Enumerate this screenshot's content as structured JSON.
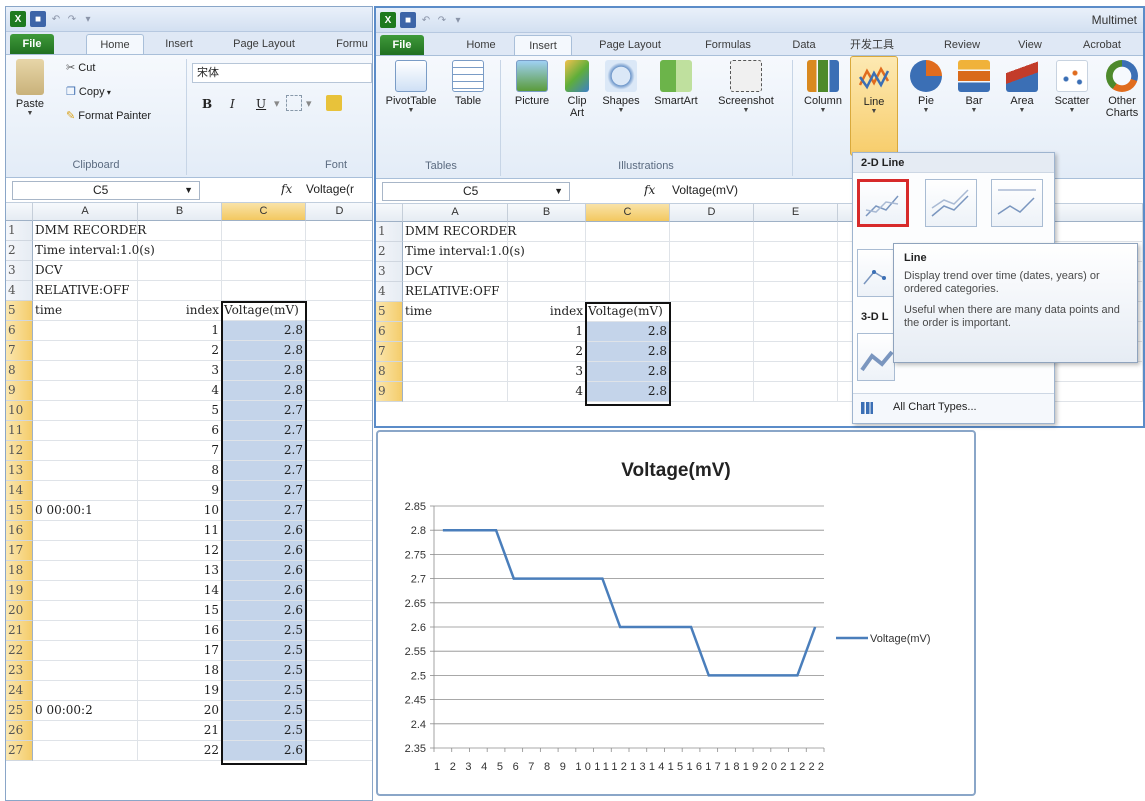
{
  "left_window": {
    "tabs": [
      "File",
      "Home",
      "Insert",
      "Page Layout",
      "Formu"
    ],
    "clipboard": {
      "paste": "Paste",
      "cut": "Cut",
      "copy": "Copy",
      "format_painter": "Format Painter",
      "group": "Clipboard"
    },
    "font": {
      "name": "宋体",
      "bold": "B",
      "italic": "I",
      "underline": "U",
      "group": "Font"
    },
    "namebox": "C5",
    "fx": "fx",
    "formula": "Voltage(r",
    "columns": [
      "A",
      "B",
      "C",
      "D"
    ],
    "rows": [
      {
        "n": "1",
        "a": "DMM RECORDER",
        "b": "",
        "c": ""
      },
      {
        "n": "2",
        "a": "Time interval:1.0(s)",
        "b": "",
        "c": ""
      },
      {
        "n": "3",
        "a": "DCV",
        "b": "",
        "c": ""
      },
      {
        "n": "4",
        "a": "RELATIVE:OFF",
        "b": "",
        "c": ""
      },
      {
        "n": "5",
        "a": "time",
        "b": "index",
        "c": "Voltage(mV)"
      },
      {
        "n": "6",
        "a": "",
        "b": "1",
        "c": "2.8"
      },
      {
        "n": "7",
        "a": "",
        "b": "2",
        "c": "2.8"
      },
      {
        "n": "8",
        "a": "",
        "b": "3",
        "c": "2.8"
      },
      {
        "n": "9",
        "a": "",
        "b": "4",
        "c": "2.8"
      },
      {
        "n": "10",
        "a": "",
        "b": "5",
        "c": "2.7"
      },
      {
        "n": "11",
        "a": "",
        "b": "6",
        "c": "2.7"
      },
      {
        "n": "12",
        "a": "",
        "b": "7",
        "c": "2.7"
      },
      {
        "n": "13",
        "a": "",
        "b": "8",
        "c": "2.7"
      },
      {
        "n": "14",
        "a": "",
        "b": "9",
        "c": "2.7"
      },
      {
        "n": "15",
        "a": "0 00:00:1",
        "b": "10",
        "c": "2.7"
      },
      {
        "n": "16",
        "a": "",
        "b": "11",
        "c": "2.6"
      },
      {
        "n": "17",
        "a": "",
        "b": "12",
        "c": "2.6"
      },
      {
        "n": "18",
        "a": "",
        "b": "13",
        "c": "2.6"
      },
      {
        "n": "19",
        "a": "",
        "b": "14",
        "c": "2.6"
      },
      {
        "n": "20",
        "a": "",
        "b": "15",
        "c": "2.6"
      },
      {
        "n": "21",
        "a": "",
        "b": "16",
        "c": "2.5"
      },
      {
        "n": "22",
        "a": "",
        "b": "17",
        "c": "2.5"
      },
      {
        "n": "23",
        "a": "",
        "b": "18",
        "c": "2.5"
      },
      {
        "n": "24",
        "a": "",
        "b": "19",
        "c": "2.5"
      },
      {
        "n": "25",
        "a": "0 00:00:2",
        "b": "20",
        "c": "2.5"
      },
      {
        "n": "26",
        "a": "",
        "b": "21",
        "c": "2.5"
      },
      {
        "n": "27",
        "a": "",
        "b": "22",
        "c": "2.6"
      }
    ]
  },
  "right_window": {
    "title": "Multimet",
    "tabs": [
      "File",
      "Home",
      "Insert",
      "Page Layout",
      "Formulas",
      "Data",
      "开发工具",
      "Review",
      "View",
      "Acrobat"
    ],
    "ribbon": {
      "pivottable": "PivotTable",
      "table": "Table",
      "tables_group": "Tables",
      "picture": "Picture",
      "clip_art": "Clip Art",
      "shapes": "Shapes",
      "smartart": "SmartArt",
      "screenshot": "Screenshot",
      "illustrations_group": "Illustrations",
      "column": "Column",
      "line": "Line",
      "pie": "Pie",
      "bar": "Bar",
      "area": "Area",
      "scatter": "Scatter",
      "other_charts": "Other Charts"
    },
    "namebox": "C5",
    "fx": "fx",
    "formula": "Voltage(mV)",
    "columns": [
      "A",
      "B",
      "C",
      "D",
      "E",
      "I"
    ],
    "rows": [
      {
        "n": "1",
        "a": "DMM RECORDER",
        "b": "",
        "c": ""
      },
      {
        "n": "2",
        "a": "Time interval:1.0(s)",
        "b": "",
        "c": ""
      },
      {
        "n": "3",
        "a": "DCV",
        "b": "",
        "c": ""
      },
      {
        "n": "4",
        "a": "RELATIVE:OFF",
        "b": "",
        "c": ""
      },
      {
        "n": "5",
        "a": "time",
        "b": "index",
        "c": "Voltage(mV)"
      },
      {
        "n": "6",
        "a": "",
        "b": "1",
        "c": "2.8"
      },
      {
        "n": "7",
        "a": "",
        "b": "2",
        "c": "2.8"
      },
      {
        "n": "8",
        "a": "",
        "b": "3",
        "c": "2.8"
      },
      {
        "n": "9",
        "a": "",
        "b": "4",
        "c": "2.8"
      }
    ]
  },
  "chart_menu": {
    "section_2d": "2-D Line",
    "section_3d": "3-D L",
    "all_types": "All Chart Types...",
    "tooltip": {
      "title": "Line",
      "p1": "Display trend over time (dates, years) or ordered categories.",
      "p2": "Useful when there are many data points and the order is important."
    }
  },
  "chart_data": {
    "type": "line",
    "title": "Voltage(mV)",
    "categories": [
      "1",
      "2",
      "3",
      "4",
      "5",
      "6",
      "7",
      "8",
      "9",
      "10",
      "11",
      "12",
      "13",
      "14",
      "15",
      "16",
      "17",
      "18",
      "19",
      "20",
      "21",
      "22"
    ],
    "tick_labels": "1 2 3 4 5 6 7 8 9 101112131415161718192021222",
    "series": [
      {
        "name": "Voltage(mV)",
        "values": [
          2.8,
          2.8,
          2.8,
          2.8,
          2.7,
          2.7,
          2.7,
          2.7,
          2.7,
          2.7,
          2.6,
          2.6,
          2.6,
          2.6,
          2.6,
          2.5,
          2.5,
          2.5,
          2.5,
          2.5,
          2.5,
          2.6
        ],
        "color": "#4a7ebb"
      }
    ],
    "yticks": [
      "2.85",
      "2.8",
      "2.75",
      "2.7",
      "2.65",
      "2.6",
      "2.55",
      "2.5",
      "2.45",
      "2.4",
      "2.35"
    ],
    "ylim": [
      2.35,
      2.85
    ],
    "grid": true,
    "legend": "right"
  }
}
